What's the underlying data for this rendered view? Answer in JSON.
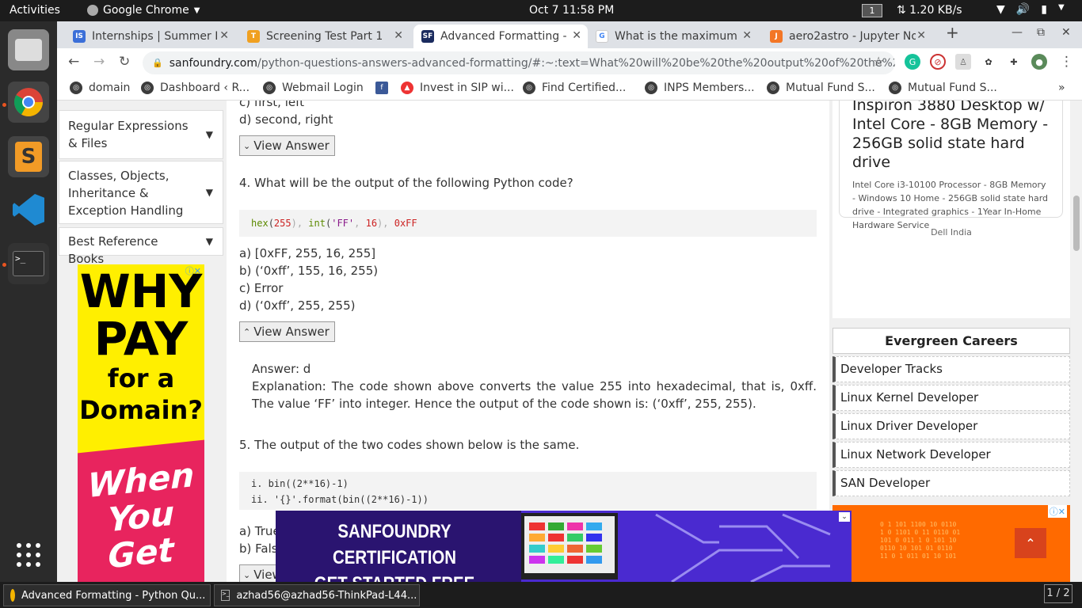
{
  "topbar": {
    "activities": "Activities",
    "app_name": "Google Chrome",
    "clock": "Oct 7  11:58 PM",
    "workspace": "1",
    "network": "⇅ 1.20 KB/s"
  },
  "tabs": [
    {
      "label": "Internships | Summer In",
      "favicon": "IS",
      "color": "#3b6fd8"
    },
    {
      "label": "Screening Test Part 1",
      "favicon": "T",
      "color": "#f0a020"
    },
    {
      "label": "Advanced Formatting - P",
      "favicon": "SF",
      "color": "#1a2b5e"
    },
    {
      "label": "What is the maximum po",
      "favicon": "G",
      "color": "#ffffff"
    },
    {
      "label": "aero2astro - Jupyter No",
      "favicon": "J",
      "color": "#f37626"
    }
  ],
  "toolbar": {
    "url_host": "sanfoundry.com",
    "url_path": "/python-questions-answers-advanced-formatting/#:~:text=What%20will%20be%20the%20output%20of%20the%20foll..."
  },
  "bookmarks": [
    "domain",
    "Dashboard ‹ R...",
    "Webmail Login",
    "Invest in SIP wi...",
    "Find Certified...",
    "INPS Members...",
    "Mutual Fund S...",
    "Mutual Fund S..."
  ],
  "sidebar": {
    "items": [
      "Regular Expressions & Files",
      "Classes, Objects, Inheritance & Exception Handling",
      "Best Reference Books"
    ]
  },
  "left_ad": {
    "line1": "WHY",
    "line2": "PAY",
    "line3": "for a",
    "line4": "Domain?",
    "line5": "When",
    "line6": "You",
    "line7": "Get"
  },
  "content": {
    "prev_option_c": "c) first, left",
    "prev_option_d": "d) second, right",
    "view_answer": "View Answer",
    "q4": "4. What will be the output of the following Python code?",
    "q4_code": {
      "a": "hex",
      "b": "(",
      "c": "255",
      "d": "),",
      "e": "int",
      "f": "(",
      "g": "'FF'",
      "h": ",",
      "i": "16",
      "j": "),",
      "k": "0xFF"
    },
    "q4_options": [
      "a) [0xFF, 255, 16, 255]",
      "b) (‘0xff’, 155, 16, 255)",
      "c) Error",
      "d) (‘0xff’, 255, 255)"
    ],
    "q4_answer": "Answer: d",
    "q4_explanation": "Explanation: The code shown above converts the value 255 into hexadecimal, that is, 0xff. The value ‘FF’ into integer. Hence the output of the code shown is: (‘0xff’, 255, 255).",
    "q5": "5. The output of the two codes shown below is the same.",
    "q5_code_line1": "i. bin((2**16)-1)",
    "q5_code_line2": "ii. '{}'.format(bin((2**16)-1))",
    "q5_options": [
      "a) True",
      "b) False"
    ]
  },
  "right": {
    "product_title": "Inspiron 3880 Desktop w/ Intel Core - 8GB Memory - 256GB solid state hard drive",
    "product_desc": "Intel Core i3-10100 Processor - 8GB Memory - Windows 10 Home - 256GB solid state hard drive - Integrated graphics - 1Year In-Home Hardware Service",
    "product_brand": "Dell India",
    "careers_title": "Evergreen Careers",
    "careers": [
      "Developer Tracks",
      "Linux Kernel Developer",
      "Linux Driver Developer",
      "Linux Network Developer",
      "SAN Developer"
    ]
  },
  "banner": {
    "line1": "SANFOUNDRY CERTIFICATION",
    "line2": "GET STARTED FREE"
  },
  "taskbar": {
    "items": [
      "Advanced Formatting - Python Qu...",
      "azhad56@azhad56-ThinkPad-L44..."
    ],
    "pager": "1 / 2"
  }
}
